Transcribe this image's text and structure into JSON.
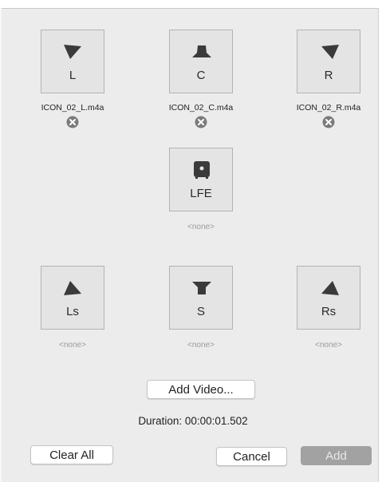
{
  "colors": {
    "tile_bg": "#e4e4e4",
    "icon": "#3a3a3a",
    "remove_icon": "#7b7b7b",
    "add_disabled": "#a2a2a2"
  },
  "channels": {
    "L": {
      "label": "L",
      "file": "ICON_02_L.m4a",
      "icon": "speaker-left-icon"
    },
    "C": {
      "label": "C",
      "file": "ICON_02_C.m4a",
      "icon": "speaker-center-icon"
    },
    "R": {
      "label": "R",
      "file": "ICON_02_R.m4a",
      "icon": "speaker-right-icon"
    },
    "LFE": {
      "label": "LFE",
      "file": "<none>",
      "icon": "subwoofer-icon"
    },
    "Ls": {
      "label": "Ls",
      "file": "<none>",
      "icon": "speaker-left-surround-icon"
    },
    "S": {
      "label": "S",
      "file": "<none>",
      "icon": "speaker-surround-icon"
    },
    "Rs": {
      "label": "Rs",
      "file": "<none>",
      "icon": "speaker-right-surround-icon"
    }
  },
  "add_video_label": "Add Video...",
  "duration_text": "Duration: 00:00:01.502",
  "buttons": {
    "clear_all": "Clear All",
    "cancel": "Cancel",
    "add": "Add"
  }
}
